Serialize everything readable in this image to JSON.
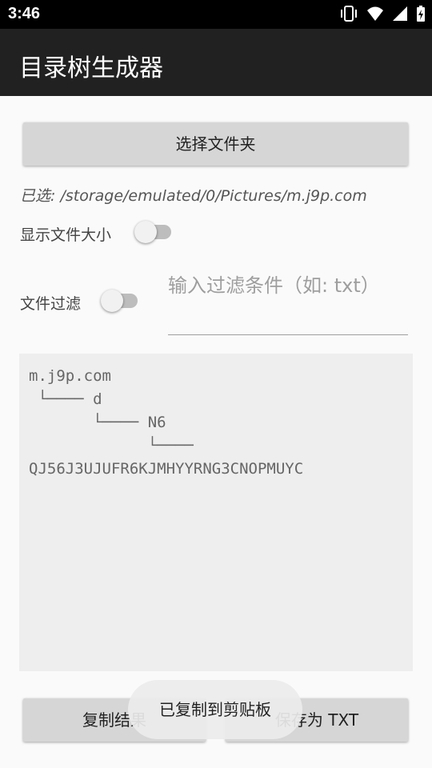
{
  "status_bar": {
    "time": "3:46"
  },
  "app_bar": {
    "title": "目录树生成器"
  },
  "select_folder_button": {
    "label": "选择文件夹"
  },
  "selected_path": {
    "text": "已选: /storage/emulated/0/Pictures/m.j9p.com"
  },
  "show_size": {
    "label": "显示文件大小",
    "enabled": false
  },
  "file_filter": {
    "label": "文件过滤",
    "enabled": false,
    "placeholder": "输入过滤条件（如: txt）"
  },
  "result": {
    "text": "m.j9p.com\n └──── d\n       └──── N6\n             └────\nQJ56J3UJUFR6KJMHYYRNG3CNOPMUYC"
  },
  "copy_button": {
    "label": "复制结果"
  },
  "save_button": {
    "label": "保存为 TXT"
  },
  "toast": {
    "message": "已复制到剪贴板"
  }
}
